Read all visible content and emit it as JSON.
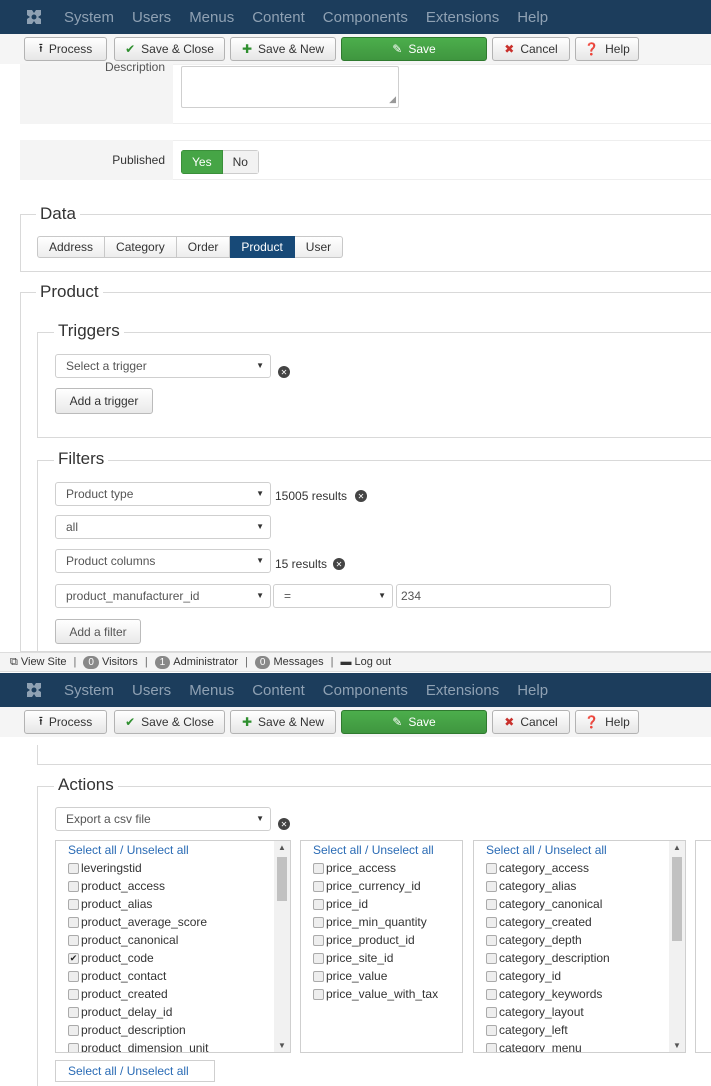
{
  "nav": {
    "logo_icon": "joomla-logo-icon",
    "menu": [
      "System",
      "Users",
      "Menus",
      "Content",
      "Components",
      "Extensions",
      "Help"
    ]
  },
  "toolbar": {
    "process": "Process",
    "save_close": "Save & Close",
    "save_new": "Save & New",
    "save": "Save",
    "cancel": "Cancel",
    "help": "Help"
  },
  "form": {
    "description_label": "Description",
    "published_label": "Published",
    "published_yes": "Yes",
    "published_no": "No",
    "published_value": "Yes"
  },
  "data_section": {
    "legend": "Data",
    "tabs": [
      "Address",
      "Category",
      "Order",
      "Product",
      "User"
    ],
    "active_tab": "Product"
  },
  "product_section": {
    "legend": "Product",
    "triggers": {
      "legend": "Triggers",
      "select_placeholder": "Select a trigger",
      "add_button": "Add a trigger"
    },
    "filters": {
      "legend": "Filters",
      "product_type": "Product type",
      "product_type_results": "15005 results",
      "type_value": "all",
      "product_columns": "Product columns",
      "columns_results": "15 results",
      "column_field": "product_manufacturer_id",
      "operator": "=",
      "value": "234",
      "add_button": "Add a filter"
    }
  },
  "statusbar": {
    "view_site": "View Site",
    "visitors_count": "0",
    "visitors": "Visitors",
    "admin_count": "1",
    "admin": "Administrator",
    "messages_count": "0",
    "messages": "Messages",
    "logout": "Log out"
  },
  "actions": {
    "legend": "Actions",
    "select_value": "Export a csv file",
    "select_all": "Select all / Unselect all",
    "list1": [
      {
        "label": "leveringstid",
        "checked": false
      },
      {
        "label": "product_access",
        "checked": false
      },
      {
        "label": "product_alias",
        "checked": false
      },
      {
        "label": "product_average_score",
        "checked": false
      },
      {
        "label": "product_canonical",
        "checked": false
      },
      {
        "label": "product_code",
        "checked": true
      },
      {
        "label": "product_contact",
        "checked": false
      },
      {
        "label": "product_created",
        "checked": false
      },
      {
        "label": "product_delay_id",
        "checked": false
      },
      {
        "label": "product_description",
        "checked": false
      },
      {
        "label": "product_dimension_unit",
        "checked": false
      }
    ],
    "list2": [
      {
        "label": "price_access",
        "checked": false
      },
      {
        "label": "price_currency_id",
        "checked": false
      },
      {
        "label": "price_id",
        "checked": false
      },
      {
        "label": "price_min_quantity",
        "checked": false
      },
      {
        "label": "price_product_id",
        "checked": false
      },
      {
        "label": "price_site_id",
        "checked": false
      },
      {
        "label": "price_value",
        "checked": false
      },
      {
        "label": "price_value_with_tax",
        "checked": false
      }
    ],
    "list3": [
      {
        "label": "category_access",
        "checked": false
      },
      {
        "label": "category_alias",
        "checked": false
      },
      {
        "label": "category_canonical",
        "checked": false
      },
      {
        "label": "category_created",
        "checked": false
      },
      {
        "label": "category_depth",
        "checked": false
      },
      {
        "label": "category_description",
        "checked": false
      },
      {
        "label": "category_id",
        "checked": false
      },
      {
        "label": "category_keywords",
        "checked": false
      },
      {
        "label": "category_layout",
        "checked": false
      },
      {
        "label": "category_left",
        "checked": false
      },
      {
        "label": "category_menu",
        "checked": false
      }
    ]
  }
}
